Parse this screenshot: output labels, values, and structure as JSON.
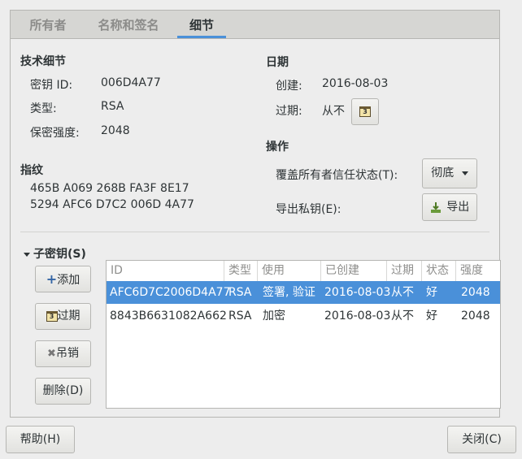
{
  "tabs": [
    "所有者",
    "名称和签名",
    "细节"
  ],
  "active_tab": 2,
  "tech": {
    "header": "技术细节",
    "key_id_label": "密钥 ID:",
    "key_id_value": "006D4A77",
    "type_label": "类型:",
    "type_value": "RSA",
    "strength_label": "保密强度:",
    "strength_value": "2048"
  },
  "fingerprint": {
    "header": "指纹",
    "line1": "465B A069 268B FA3F 8E17",
    "line2": "5294 AFC6 D7C2 006D 4A77"
  },
  "dates": {
    "header": "日期",
    "created_label": "创建:",
    "created_value": "2016-08-03",
    "expires_label": "过期:",
    "expires_value": "从不"
  },
  "actions": {
    "header": "操作",
    "override_label": "覆盖所有者信任状态(T):",
    "trust_value": "彻底",
    "export_label": "导出私钥(E):",
    "export_button": "导出"
  },
  "subkeys": {
    "header": "子密钥(S)",
    "buttons": {
      "add": "添加",
      "expire": "过期",
      "revoke": "吊销",
      "delete": "删除(D)"
    },
    "columns": [
      "ID",
      "类型",
      "使用",
      "已创建",
      "过期",
      "状态",
      "强度"
    ],
    "rows": [
      {
        "id": "AFC6D7C2006D4A77",
        "type": "RSA",
        "usage": "签署, 验证",
        "created": "2016-08-03",
        "expires": "从不",
        "status": "好",
        "strength": "2048"
      },
      {
        "id": "8843B6631082A662",
        "type": "RSA",
        "usage": "加密",
        "created": "2016-08-03",
        "expires": "从不",
        "status": "好",
        "strength": "2048"
      }
    ],
    "selected_row": 0
  },
  "footer": {
    "help": "帮助(H)",
    "close": "关闭(C)"
  },
  "colors": {
    "accent": "#4a90d9",
    "background": "#ededed",
    "tabbar": "#d6d6d3"
  }
}
